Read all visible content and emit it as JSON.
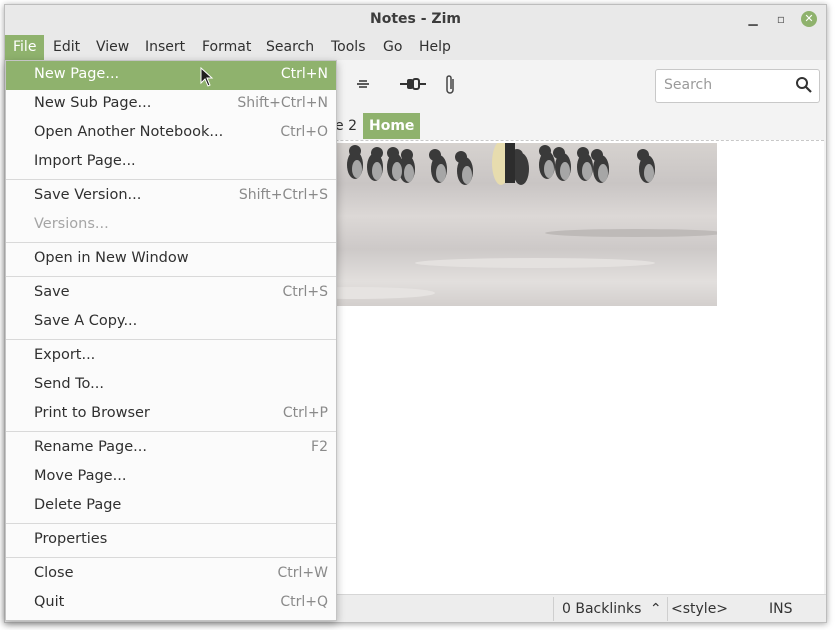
{
  "window": {
    "title": "Notes - Zim"
  },
  "menubar": {
    "items": [
      "File",
      "Edit",
      "View",
      "Insert",
      "Format",
      "Search",
      "Tools",
      "Go",
      "Help"
    ]
  },
  "toolbar": {
    "search_placeholder": "Search"
  },
  "pathbar": {
    "crumbs": [
      "e 2",
      "Home"
    ]
  },
  "statusbar": {
    "backlinks": "0 Backlinks",
    "style": "<style>",
    "mode": "INS"
  },
  "file_menu": {
    "new_page": {
      "label": "New Page...",
      "accel": "Ctrl+N"
    },
    "new_sub_page": {
      "label": "New Sub Page...",
      "accel": "Shift+Ctrl+N"
    },
    "open_another": {
      "label": "Open Another Notebook...",
      "accel": "Ctrl+O"
    },
    "import_page": {
      "label": "Import Page..."
    },
    "save_version": {
      "label": "Save Version...",
      "accel": "Shift+Ctrl+S"
    },
    "versions": {
      "label": "Versions..."
    },
    "open_new_window": {
      "label": "Open in New Window"
    },
    "save": {
      "label": "Save",
      "accel": "Ctrl+S"
    },
    "save_copy": {
      "label": "Save A Copy..."
    },
    "export": {
      "label": "Export..."
    },
    "send_to": {
      "label": "Send To..."
    },
    "print_browser": {
      "label": "Print to Browser",
      "accel": "Ctrl+P"
    },
    "rename_page": {
      "label": "Rename Page...",
      "accel": "F2"
    },
    "move_page": {
      "label": "Move Page..."
    },
    "delete_page": {
      "label": "Delete Page"
    },
    "properties": {
      "label": "Properties"
    },
    "close": {
      "label": "Close",
      "accel": "Ctrl+W"
    },
    "quit": {
      "label": "Quit",
      "accel": "Ctrl+Q"
    }
  },
  "colors": {
    "accent": "#8fb26d"
  },
  "icons": [
    "minimize-icon",
    "restore-icon",
    "close-icon",
    "strike-icon",
    "link-icon",
    "attach-icon",
    "search-icon",
    "chevron-up-icon",
    "mouse-pointer-icon"
  ]
}
